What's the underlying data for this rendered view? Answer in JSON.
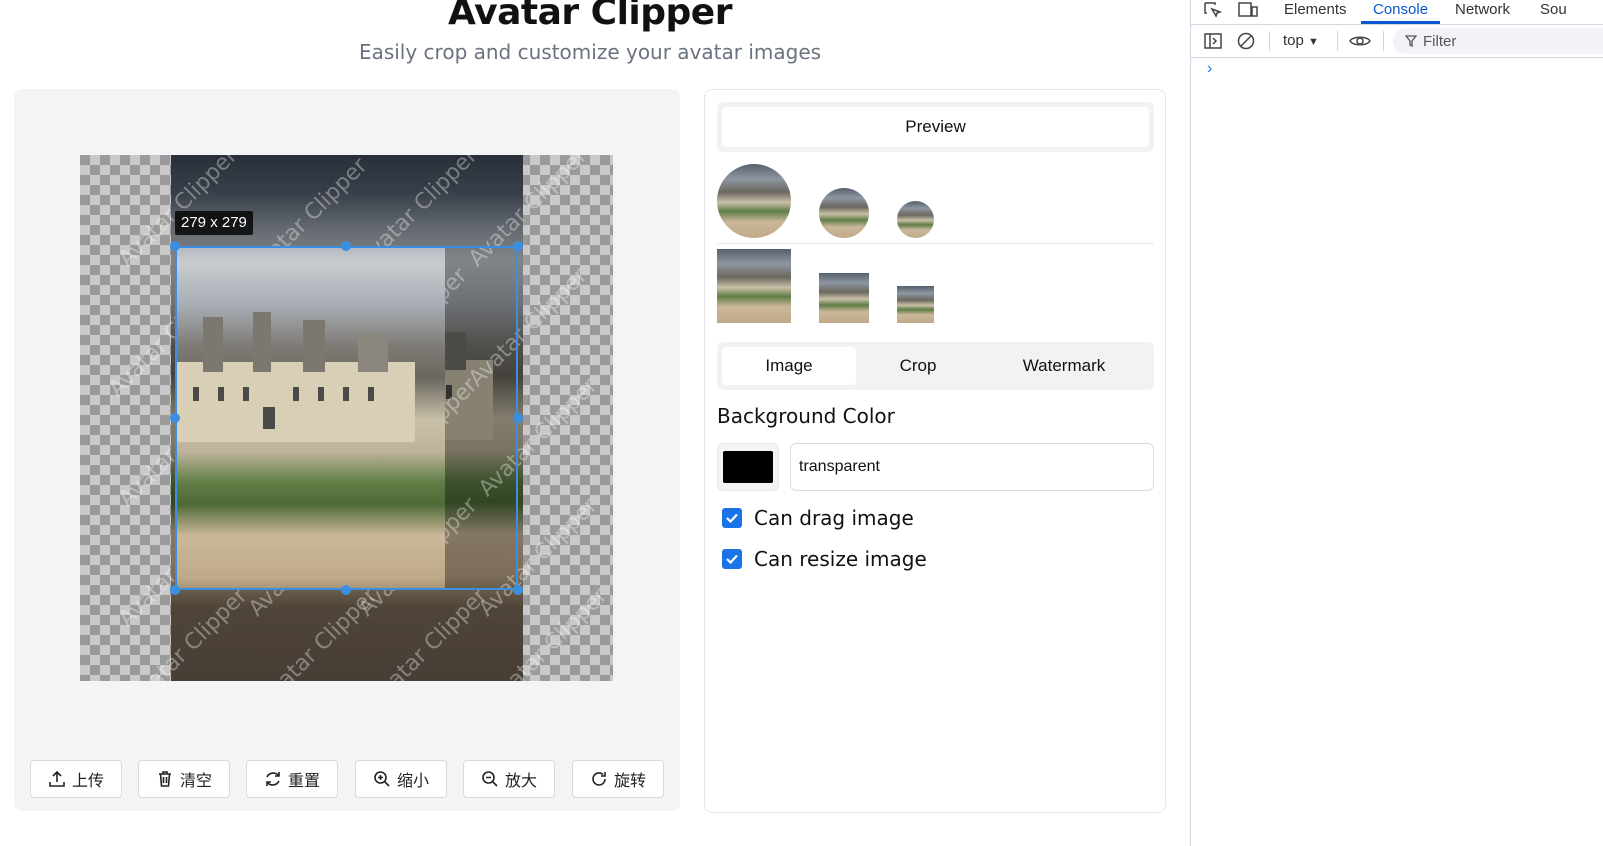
{
  "header": {
    "title": "Avatar Clipper",
    "subtitle": "Easily crop and customize your avatar images"
  },
  "editor": {
    "crop_size_label": "279 x 279",
    "watermark_text": "Avatar Clipper",
    "toolbar": {
      "upload_label": "上传",
      "clear_label": "清空",
      "reset_label": "重置",
      "zoom_out_label": "缩小",
      "zoom_in_label": "放大",
      "rotate_label": "旋转"
    }
  },
  "panel": {
    "preview_tab": "Preview",
    "tabs": [
      "Image",
      "Crop",
      "Watermark"
    ],
    "active_tab": "Image",
    "background_color_label": "Background Color",
    "background_color_swatch": "#000000",
    "background_color_value": "transparent",
    "can_drag_label": "Can drag image",
    "can_drag_checked": true,
    "can_resize_label": "Can resize image",
    "can_resize_checked": true
  },
  "devtools": {
    "tabs": [
      "Elements",
      "Console",
      "Network",
      "Sou"
    ],
    "active_tab": "Console",
    "context": "top",
    "filter_placeholder": "Filter",
    "prompt": "›",
    "accent_color": "#0b57d0"
  }
}
